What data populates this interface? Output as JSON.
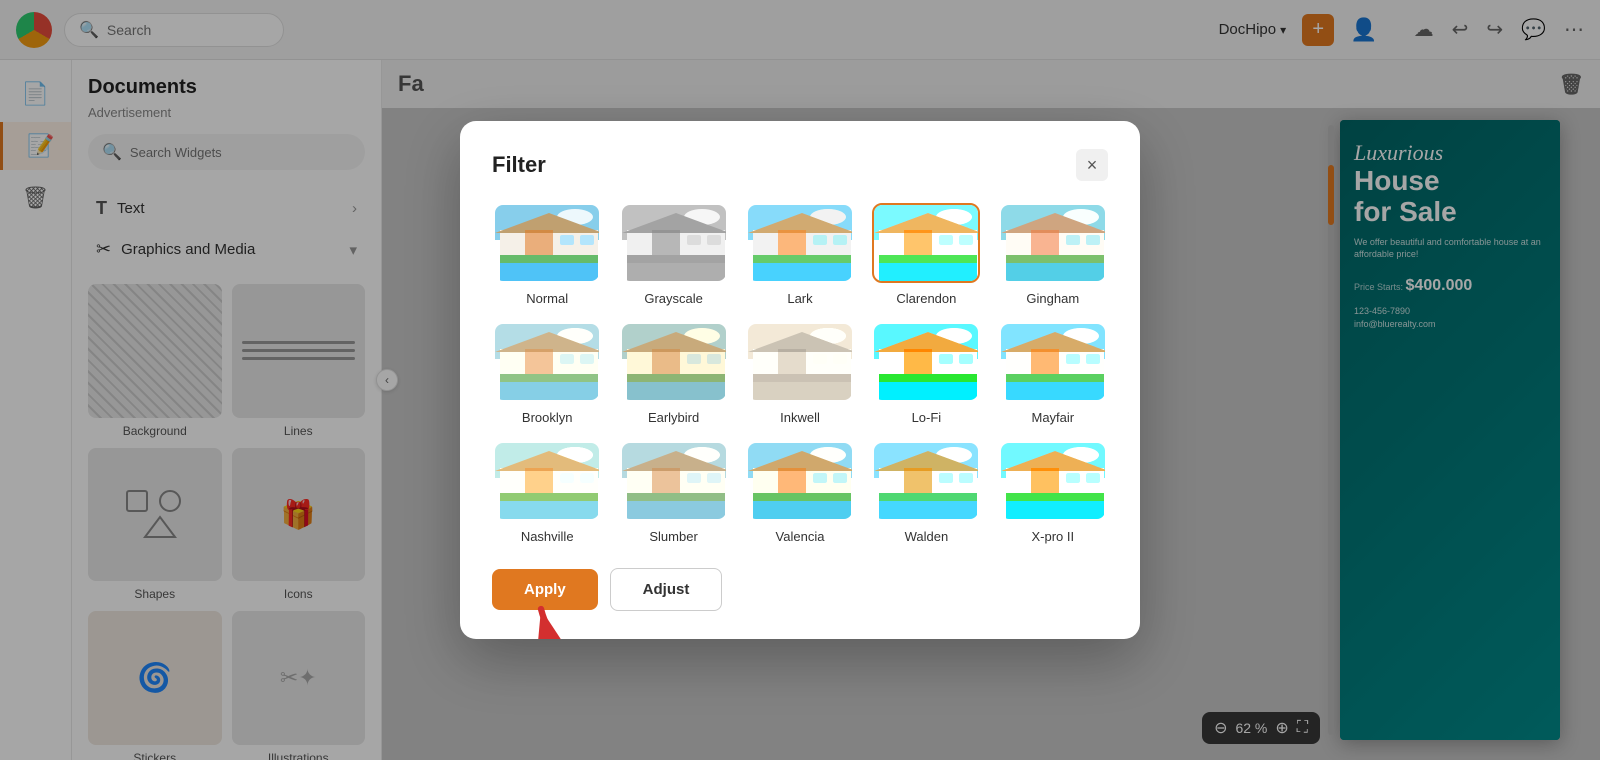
{
  "topbar": {
    "search_placeholder": "Search",
    "brand_name": "DocHipo",
    "plus_icon": "+",
    "chevron": "▾"
  },
  "sidebar": {
    "items": [
      {
        "name": "documents",
        "icon": "📄"
      },
      {
        "name": "notes",
        "icon": "📝"
      },
      {
        "name": "trash",
        "icon": "🗑"
      }
    ]
  },
  "panel": {
    "title": "Documents",
    "subtitle": "Advertisement",
    "search_placeholder": "Search Widgets",
    "nav_items": [
      {
        "label": "Text",
        "has_chevron": true
      },
      {
        "label": "Graphics and Media",
        "has_chevron": true
      }
    ],
    "grid_items": [
      {
        "label": "Background"
      },
      {
        "label": "Lines"
      },
      {
        "label": "Shapes"
      },
      {
        "label": "Icons"
      },
      {
        "label": "Stickers"
      },
      {
        "label": "Illustrations"
      }
    ]
  },
  "canvas": {
    "title": "Fa",
    "zoom_percent": "62 %",
    "document": {
      "title_script": "Luxurious",
      "title_main": "House\nfor Sale",
      "subtitle": "We offer beautiful and comfortable house at an affordable price!",
      "price_label": "Price Starts:",
      "price": "$400.000",
      "contact_line1": "123-456-7890",
      "contact_line2": "info@bluerealty.com"
    }
  },
  "modal": {
    "title": "Filter",
    "close_label": "×",
    "filters": [
      {
        "id": "normal",
        "label": "Normal",
        "selected": false,
        "css_filter": ""
      },
      {
        "id": "grayscale",
        "label": "Grayscale",
        "selected": false,
        "css_filter": "grayscale(100%)"
      },
      {
        "id": "lark",
        "label": "Lark",
        "selected": false,
        "css_filter": "brightness(1.1) contrast(0.9) saturate(1.2)"
      },
      {
        "id": "clarendon",
        "label": "Clarendon",
        "selected": true,
        "css_filter": "contrast(1.2) saturate(1.35) brightness(1.1)"
      },
      {
        "id": "gingham",
        "label": "Gingham",
        "selected": false,
        "css_filter": "brightness(1.05) hue-rotate(-10deg) saturate(0.9)"
      },
      {
        "id": "brooklyn",
        "label": "Brooklyn",
        "selected": false,
        "css_filter": "contrast(0.9) brightness(1.1) saturate(0.85) sepia(0.2)"
      },
      {
        "id": "earlybird",
        "label": "Earlybird",
        "selected": false,
        "css_filter": "contrast(0.9) sepia(0.4) saturate(1.1)"
      },
      {
        "id": "inkwell",
        "label": "Inkwell",
        "selected": false,
        "css_filter": "grayscale(100%) contrast(1.1) brightness(1.1) sepia(0.3)"
      },
      {
        "id": "lofi",
        "label": "Lo-Fi",
        "selected": false,
        "css_filter": "saturate(1.6) contrast(1.4)"
      },
      {
        "id": "mayfair",
        "label": "Mayfair",
        "selected": false,
        "css_filter": "contrast(1.1) saturate(1.2) brightness(1.05)"
      },
      {
        "id": "nashville",
        "label": "Nashville",
        "selected": false,
        "css_filter": "sepia(0.4) contrast(1.1) brightness(1.05) saturate(1.2)"
      },
      {
        "id": "slumber",
        "label": "Slumber",
        "selected": false,
        "css_filter": "saturate(0.7) brightness(1.05) sepia(0.2)"
      },
      {
        "id": "valencia",
        "label": "Valencia",
        "selected": false,
        "css_filter": "contrast(1.1) saturate(1.2) sepia(0.15)"
      },
      {
        "id": "walden",
        "label": "Walden",
        "selected": false,
        "css_filter": "brightness(1.1) saturate(1.3) hue-rotate(10deg)"
      },
      {
        "id": "xproii",
        "label": "X-pro II",
        "selected": false,
        "css_filter": "contrast(1.3) saturate(1.4) brightness(1.05)"
      }
    ],
    "apply_label": "Apply",
    "adjust_label": "Adjust"
  }
}
